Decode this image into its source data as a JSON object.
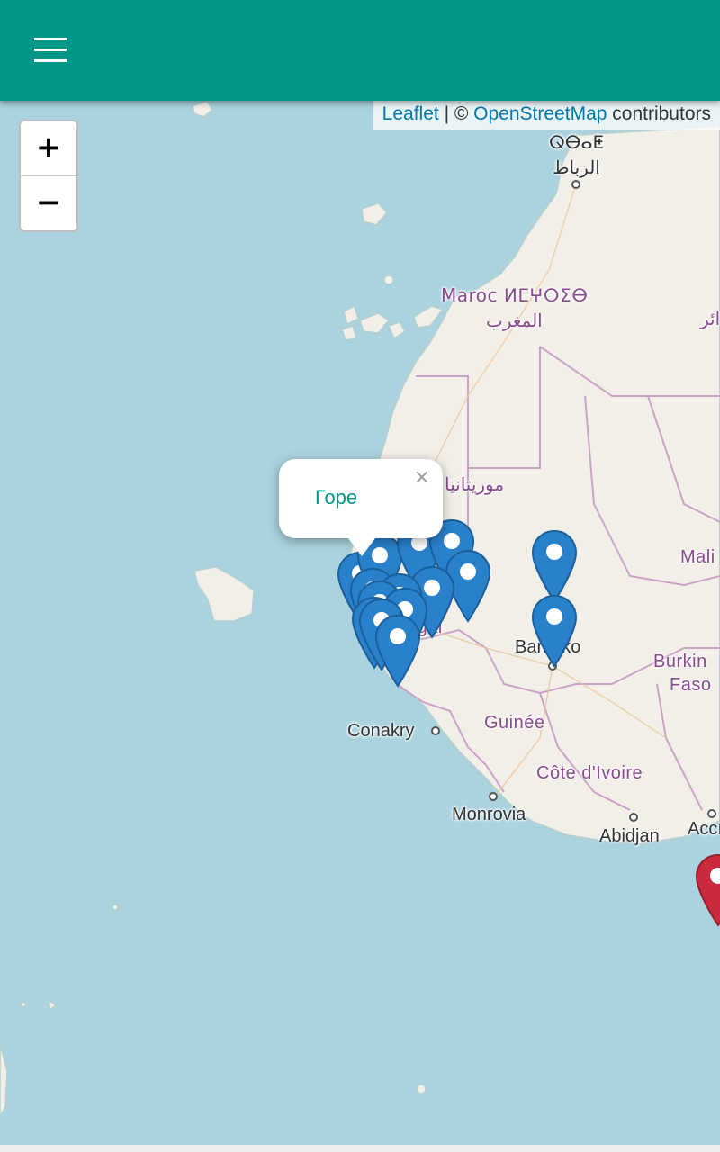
{
  "appbar": {
    "background": "#009688",
    "menu_icon": "hamburger-menu-icon"
  },
  "attribution": {
    "leaflet_link": "Leaflet",
    "separator": " | © ",
    "osm_link": "OpenStreetMap",
    "suffix": " contributors"
  },
  "zoom": {
    "in_label": "+",
    "out_label": "−"
  },
  "map_labels": {
    "rabat_tifinagh": "ⵕⴱⴰⵟ",
    "rabat_arabic": "الرباط",
    "morocco": "Maroc ⵍⵎⵖⵔⵉⴱ",
    "morocco_arabic": "المغرب",
    "algeria_partial": "ائر",
    "mauritania": "موريتانيا",
    "senegal_partial": "egal",
    "mali": "Mali",
    "bamako": "Bamako",
    "burkina_line1": "Burkin",
    "burkina_line2": "Faso",
    "conakry": "Conakry",
    "guinee": "Guinée",
    "cote_divoire": "Côte d'Ivoire",
    "monrovia": "Monrovia",
    "abidjan": "Abidjan",
    "accra_partial": "Accı"
  },
  "markers": {
    "blue_color": "#2a81cb",
    "red_color": "#cb2b3e",
    "blue_count": 16,
    "red_count": 1
  },
  "popup": {
    "text": "Горе",
    "close_label": "×"
  }
}
